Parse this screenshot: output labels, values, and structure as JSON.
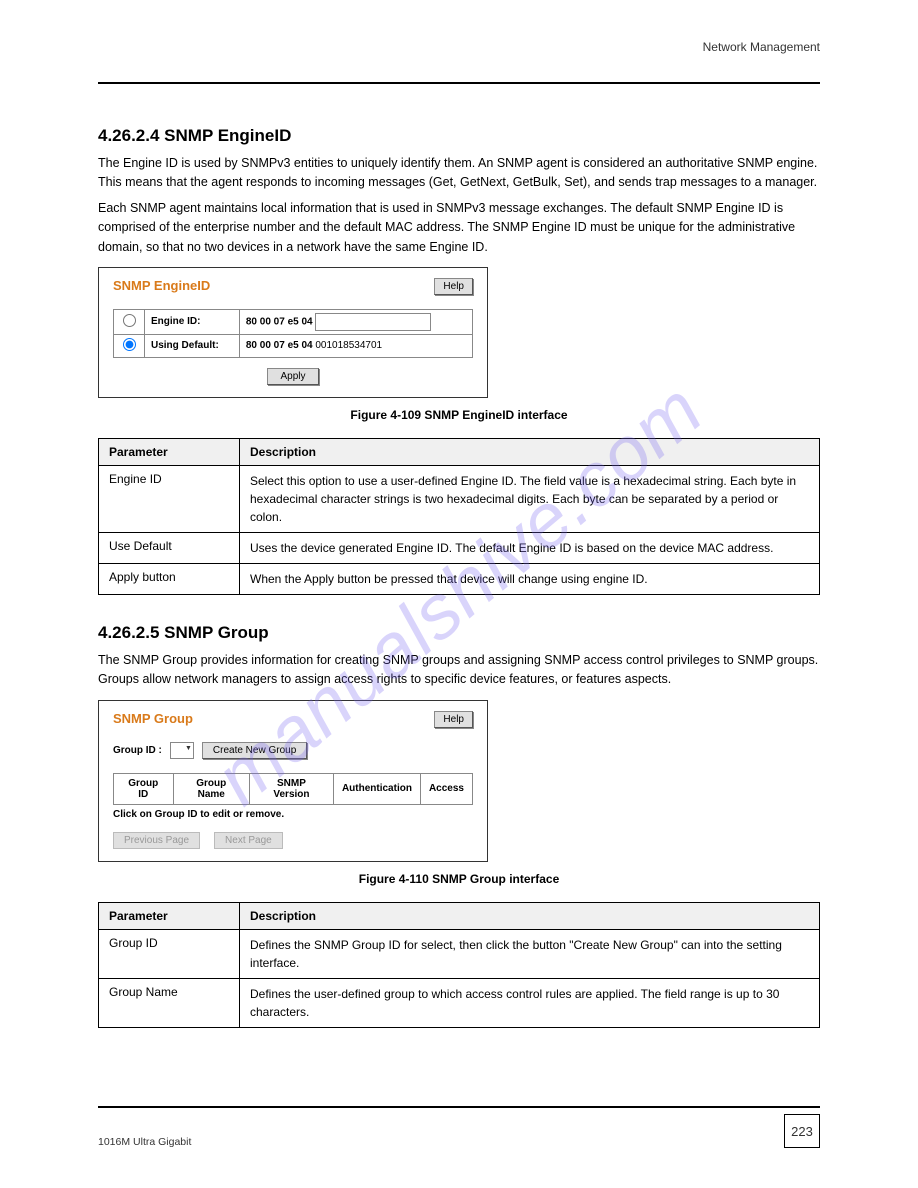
{
  "header": {
    "right": "Network Management"
  },
  "sec1": {
    "title": "4.26.2.4 SNMP EngineID",
    "p1": "The Engine ID is used by SNMPv3 entities to uniquely identify them. An SNMP agent is considered an authoritative SNMP engine. This means that the agent responds to incoming messages (Get, GetNext, GetBulk, Set), and sends trap messages to a manager.",
    "p2": "Each SNMP agent maintains local information that is used in SNMPv3 message exchanges. The default SNMP Engine ID is comprised of the enterprise number and the default MAC address. The SNMP Engine ID must be unique for the administrative domain, so that no two devices in a network have the same Engine ID."
  },
  "fig1": {
    "title": "SNMP EngineID",
    "help": "Help",
    "row1_label": "Engine ID:",
    "row1_prefix": "80 00 07 e5 04",
    "row2_label": "Using Default:",
    "row2_prefix": "80 00 07 e5 04",
    "row2_value": "001018534701",
    "apply": "Apply",
    "caption": "Figure 4-109 SNMP EngineID interface"
  },
  "table1": {
    "h1": "Parameter",
    "h2": "Description",
    "r1_p": "Engine ID",
    "r1_d": "Select this option to use a user-defined Engine ID. The field value is a hexadecimal string. Each byte in hexadecimal character strings is two hexadecimal digits. Each byte can be separated by a period or colon.",
    "r2_p": "Use Default",
    "r2_d": "Uses the device generated Engine ID. The default Engine ID is based on the device MAC address.",
    "r3_p": "Apply button",
    "r3_d": "When the Apply button be pressed that device will change using engine ID."
  },
  "sec2": {
    "title": "4.26.2.5 SNMP Group",
    "p1": "The SNMP Group provides information for creating SNMP groups and assigning SNMP access control privileges to SNMP groups. Groups allow network managers to assign access rights to specific device features, or features aspects."
  },
  "fig2": {
    "title": "SNMP Group",
    "help": "Help",
    "group_id": "Group ID :",
    "create_btn": "Create New Group",
    "th1": "Group ID",
    "th2": "Group Name",
    "th3": "SNMP Version",
    "th4": "Authentication",
    "th5": "Access",
    "caption": "Click on Group ID to edit or remove.",
    "prev": "Previous Page",
    "next": "Next Page",
    "fig_caption": "Figure 4-110 SNMP Group interface"
  },
  "table2": {
    "h1": "Parameter",
    "h2": "Description",
    "r1_p": "Group ID",
    "r1_d": "Defines the SNMP Group ID for select, then click the button \"Create New Group\" can into the setting interface.",
    "r2_p": "Group Name",
    "r2_d": "Defines the user-defined group to which access control rules are applied. The field range is up to 30 characters."
  },
  "footer": {
    "left": "1016M Ultra Gigabit",
    "page": "223"
  }
}
